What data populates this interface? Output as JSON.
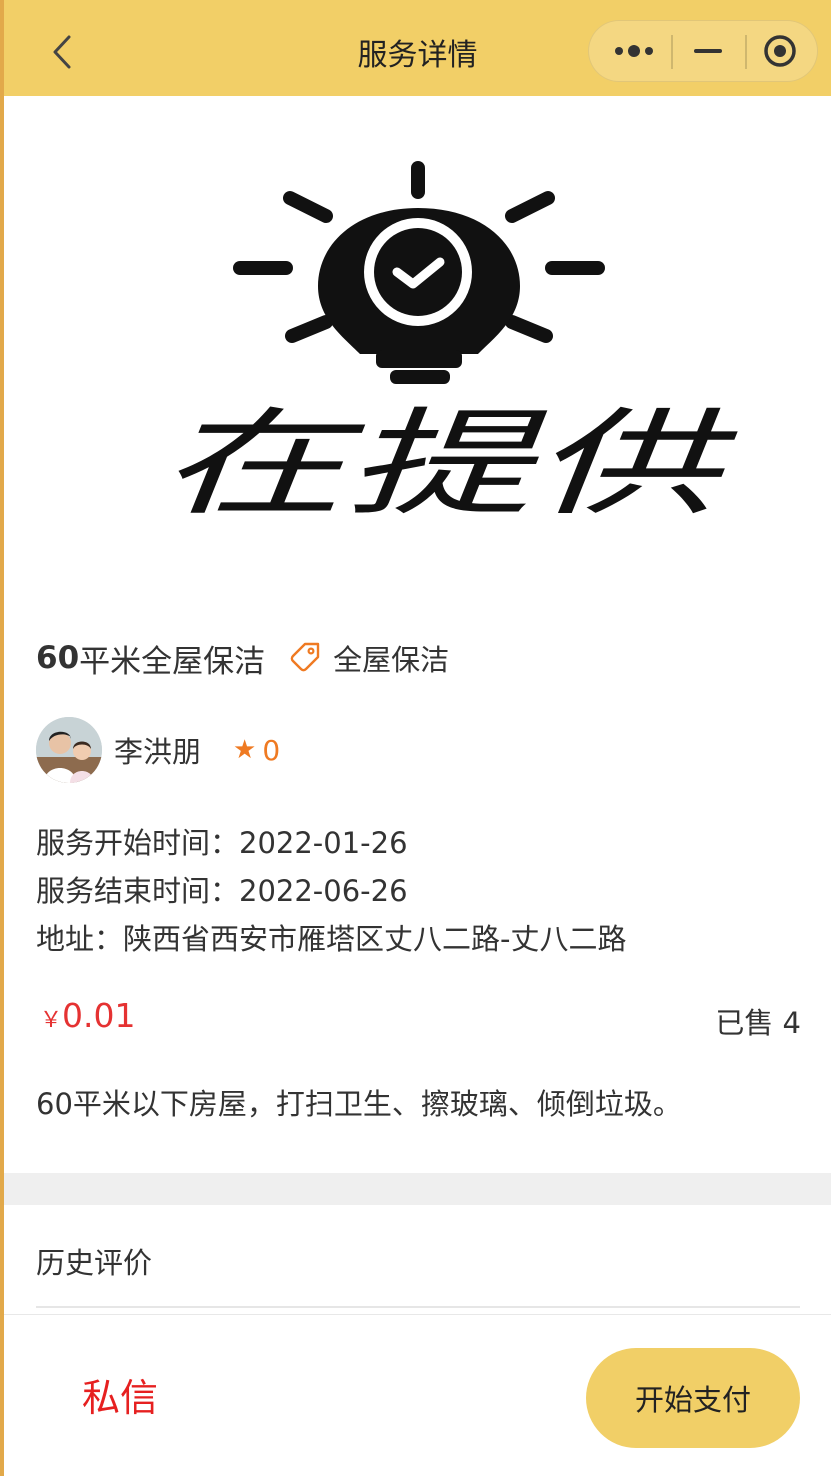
{
  "nav": {
    "title": "服务详情",
    "back_icon": "chevron-left-icon",
    "more_icon": "more-dots-icon",
    "minimize_icon": "minimize-icon",
    "close_icon": "target-close-icon"
  },
  "banner": {
    "logo_text": "在提供",
    "logo_icon": "lightbulb-check-icon"
  },
  "service": {
    "title_num": "60",
    "title_text": "平米全屋保洁",
    "tag_icon": "tag-icon",
    "tag": "全屋保洁",
    "provider": {
      "avatar_icon": "avatar",
      "name": "李洪朋",
      "star": "★",
      "rating": "0"
    },
    "start_time": "服务开始时间：2022-01-26",
    "end_time": "服务结束时间：2022-06-26",
    "address": "地址：陕西省西安市雁塔区丈八二路-丈八二路",
    "price_symbol": "￥",
    "price": "0.01",
    "sold": "已售 4",
    "description": "60平米以下房屋，打扫卫生、擦玻璃、倾倒垃圾。"
  },
  "reviews": {
    "title": "历史评价"
  },
  "bottom": {
    "message_label": "私信",
    "pay_label": "开始支付"
  },
  "colors": {
    "nav_bg": "#f2cf67",
    "price": "#e53232",
    "rating": "#ef7a22",
    "message": "#e62020",
    "pay_bg": "#f1cf67"
  }
}
